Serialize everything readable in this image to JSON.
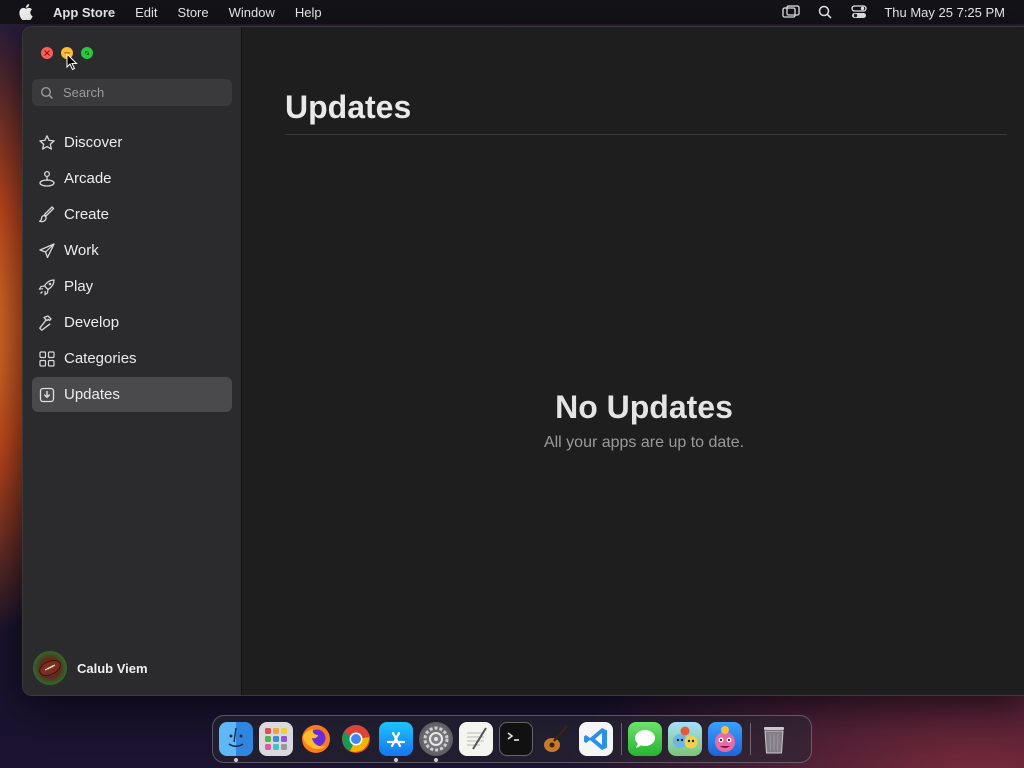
{
  "menubar": {
    "apple_icon": "apple-logo-icon",
    "app_name": "App Store",
    "menus": [
      "Edit",
      "Store",
      "Window",
      "Help"
    ],
    "status_icons": [
      "screen-mirroring-icon",
      "spotlight-search-icon",
      "control-center-icon"
    ],
    "clock": "Thu May 25  7:25 PM"
  },
  "window": {
    "traffic_lights": [
      "close",
      "minimize",
      "zoom"
    ],
    "search": {
      "placeholder": "Search",
      "value": ""
    },
    "sidebar": {
      "items": [
        {
          "label": "Discover",
          "icon": "star-icon",
          "active": false
        },
        {
          "label": "Arcade",
          "icon": "joystick-icon",
          "active": false
        },
        {
          "label": "Create",
          "icon": "paintbrush-icon",
          "active": false
        },
        {
          "label": "Work",
          "icon": "paperplane-icon",
          "active": false
        },
        {
          "label": "Play",
          "icon": "rocket-icon",
          "active": false
        },
        {
          "label": "Develop",
          "icon": "hammer-icon",
          "active": false
        },
        {
          "label": "Categories",
          "icon": "grid-icon",
          "active": false
        },
        {
          "label": "Updates",
          "icon": "download-tray-icon",
          "active": true
        }
      ]
    },
    "account": {
      "name": "Calub Viem",
      "avatar_icon": "football-avatar-icon"
    },
    "main": {
      "title": "Updates",
      "empty_title": "No Updates",
      "empty_subtitle": "All your apps are up to date."
    }
  },
  "dock": {
    "apps": [
      {
        "name": "Finder",
        "icon": "finder-icon",
        "running": true
      },
      {
        "name": "Launchpad",
        "icon": "launchpad-icon",
        "running": false
      },
      {
        "name": "Firefox",
        "icon": "firefox-icon",
        "running": false
      },
      {
        "name": "Chrome",
        "icon": "chrome-icon",
        "running": false
      },
      {
        "name": "App Store",
        "icon": "app-store-icon",
        "running": true
      },
      {
        "name": "System Settings",
        "icon": "system-settings-icon",
        "running": true
      },
      {
        "name": "TextEdit",
        "icon": "textedit-icon",
        "running": false
      },
      {
        "name": "Terminal",
        "icon": "terminal-icon",
        "running": false
      },
      {
        "name": "GarageBand",
        "icon": "garageband-icon",
        "running": false
      },
      {
        "name": "Visual Studio Code",
        "icon": "vscode-icon",
        "running": false
      },
      {
        "name": "Messages",
        "icon": "messages-icon",
        "running": false
      },
      {
        "name": "Game App 1",
        "icon": "game-characters-icon",
        "running": false
      },
      {
        "name": "Game App 2",
        "icon": "game-monster-icon",
        "running": false
      },
      {
        "name": "Trash",
        "icon": "trash-icon",
        "running": false
      }
    ]
  },
  "colors": {
    "sidebar_bg": "#2b2b2d",
    "main_bg": "#1e1e1e",
    "active_item_bg": "#4a4a4d",
    "close": "#ff5f57",
    "minimize": "#febc2e",
    "zoom": "#28c840"
  }
}
